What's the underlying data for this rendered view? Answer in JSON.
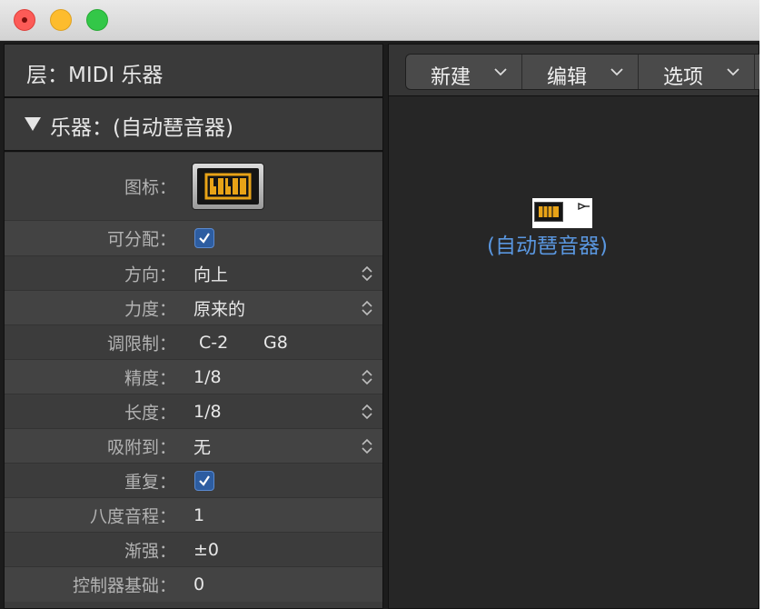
{
  "layer_header": "层：MIDI 乐器",
  "section_title": "乐器：(自动琶音器)",
  "params": {
    "icon_label": "图标：",
    "assignable_label": "可分配：",
    "assignable_checked": true,
    "direction_label": "方向：",
    "direction_value": "向上",
    "velocity_label": "力度：",
    "velocity_value": "原来的",
    "key_limit_label": "调限制：",
    "key_limit_low": "C-2",
    "key_limit_high": "G8",
    "resolution_label": "精度：",
    "resolution_value": "1/8",
    "length_label": "长度：",
    "length_value": "1/8",
    "snap_label": "吸附到：",
    "snap_value": "无",
    "repeat_label": "重复：",
    "repeat_checked": true,
    "octave_label": "八度音程：",
    "octave_value": "1",
    "crescendo_label": "渐强：",
    "crescendo_value": "±0",
    "controller_base_label": "控制器基础：",
    "controller_base_value": "0"
  },
  "toolbar": {
    "new_label": "新建",
    "edit_label": "编辑",
    "options_label": "选项"
  },
  "canvas": {
    "object_label": "(自动琶音器)"
  },
  "colors": {
    "checkbox": "#2d5da1",
    "object_label": "#5a97e0",
    "icon_accent": "#e8a317"
  }
}
